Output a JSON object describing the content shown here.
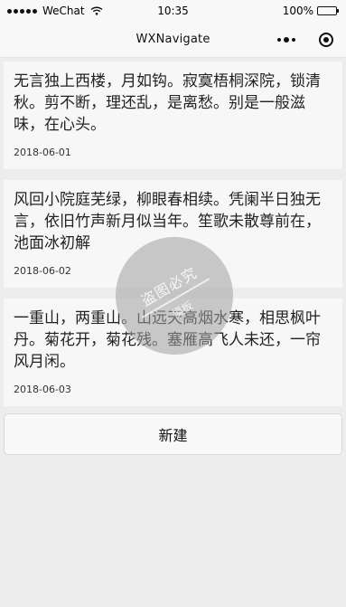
{
  "status_bar": {
    "carrier": "WeChat",
    "time": "10:35",
    "battery_percent": "100%"
  },
  "nav": {
    "title": "WXNavigate"
  },
  "items": [
    {
      "text": "无言独上西楼，月如钩。寂寞梧桐深院，锁清秋。剪不断，理还乱，是离愁。别是一般滋味，在心头。",
      "date": "2018-06-01"
    },
    {
      "text": "风回小院庭芜绿，柳眼春相续。凭阑半日独无言，依旧竹声新月似当年。笙歌未散尊前在，池面冰初解",
      "date": "2018-06-02"
    },
    {
      "text": "一重山，两重山。山远天高烟水寒，相思枫叶丹。菊花开，菊花残。塞雁高飞人未还，一帘风月闲。",
      "date": "2018-06-03"
    }
  ],
  "actions": {
    "new_label": "新建"
  },
  "watermark": {
    "top": "盗图必究",
    "bottom": "模板"
  },
  "colors": {
    "background": "#ededed",
    "card": "#f7f7f7",
    "text": "#222222"
  }
}
